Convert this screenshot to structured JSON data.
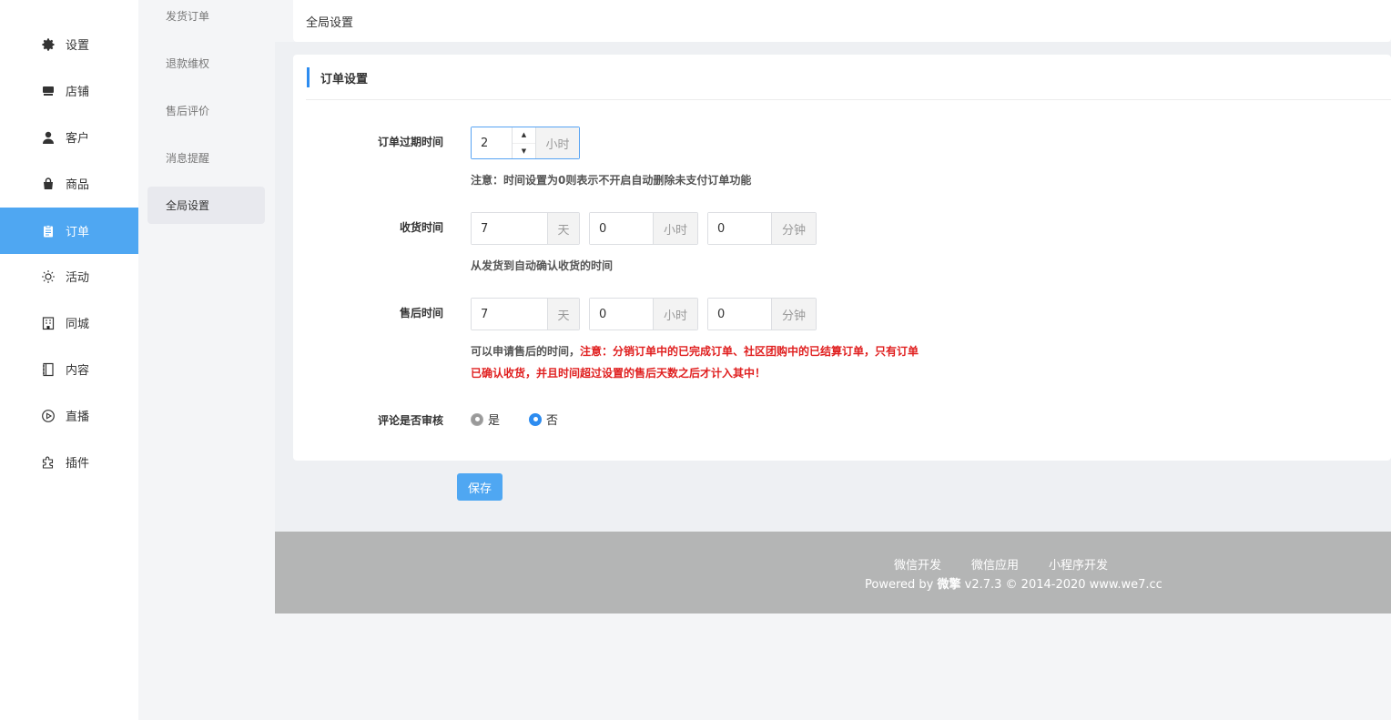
{
  "sidebar": {
    "items": [
      {
        "label": "设置",
        "icon": "gear-icon"
      },
      {
        "label": "店铺",
        "icon": "store-icon"
      },
      {
        "label": "客户",
        "icon": "user-icon"
      },
      {
        "label": "商品",
        "icon": "bag-icon"
      },
      {
        "label": "订单",
        "icon": "clipboard-icon",
        "active": true
      },
      {
        "label": "活动",
        "icon": "sun-icon"
      },
      {
        "label": "同城",
        "icon": "building-icon"
      },
      {
        "label": "内容",
        "icon": "notebook-icon"
      },
      {
        "label": "直播",
        "icon": "play-circle-icon"
      },
      {
        "label": "插件",
        "icon": "puzzle-icon"
      }
    ]
  },
  "subnav": {
    "items": [
      {
        "label": "发货订单"
      },
      {
        "label": "退款维权"
      },
      {
        "label": "售后评价"
      },
      {
        "label": "消息提醒"
      },
      {
        "label": "全局设置",
        "active": true
      }
    ]
  },
  "header": {
    "title": "全局设置"
  },
  "order_settings": {
    "title": "订单设置",
    "expire": {
      "label": "订单过期时间",
      "value": "2",
      "unit": "小时",
      "tip": "注意：时间设置为0则表示不开启自动删除未支付订单功能"
    },
    "receive": {
      "label": "收货时间",
      "days": "7",
      "days_unit": "天",
      "hours": "0",
      "hours_unit": "小时",
      "minutes": "0",
      "minutes_unit": "分钟",
      "tip": "从发货到自动确认收货的时间"
    },
    "aftersale": {
      "label": "售后时间",
      "days": "7",
      "days_unit": "天",
      "hours": "0",
      "hours_unit": "小时",
      "minutes": "0",
      "minutes_unit": "分钟",
      "tip_prefix": "可以申请售后的时间，",
      "tip_red_line1": "注意：分销订单中的已完成订单、社区团购中的已结算订单，只有订单",
      "tip_red_line2": "已确认收货，并且时间超过设置的售后天数之后才计入其中！"
    },
    "review": {
      "label": "评论是否审核",
      "options": [
        {
          "label": "是",
          "selected": false
        },
        {
          "label": "否",
          "selected": true
        }
      ]
    }
  },
  "save_label": "保存",
  "footer": {
    "links": [
      "微信开发",
      "微信应用",
      "小程序开发"
    ],
    "copy_prefix": "Powered by ",
    "brand": "微擎",
    "copy_suffix": " v2.7.3 © 2014-2020 www.we7.cc"
  },
  "colors": {
    "accent": "#4fa7f2",
    "primary": "#2d8cf0",
    "warning": "#e02020"
  }
}
